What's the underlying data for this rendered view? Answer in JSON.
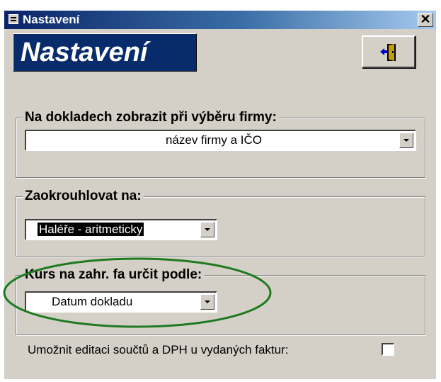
{
  "window": {
    "title": "Nastavení",
    "close_symbol": "✕"
  },
  "header": {
    "banner": "Nastavení",
    "exit_icon": "door-exit-icon"
  },
  "groups": [
    {
      "label": "Na dokladech zobrazit při výběru firmy:",
      "value": "název firmy a IČO"
    },
    {
      "label": "Zaokrouhlovat na:",
      "value": "Haléře - aritmeticky"
    },
    {
      "label": "Kurs na zahr. fa určit podle:",
      "value": "Datum dokladu"
    }
  ],
  "checkbox": {
    "label": "Umožnit editaci součtů a DPH u vydaných faktur:",
    "checked": false
  },
  "colors": {
    "titlebar": "#0a246a",
    "banner": "#082b6b",
    "highlight_ellipse": "#1e7a1e",
    "face": "#d4d0c8"
  }
}
